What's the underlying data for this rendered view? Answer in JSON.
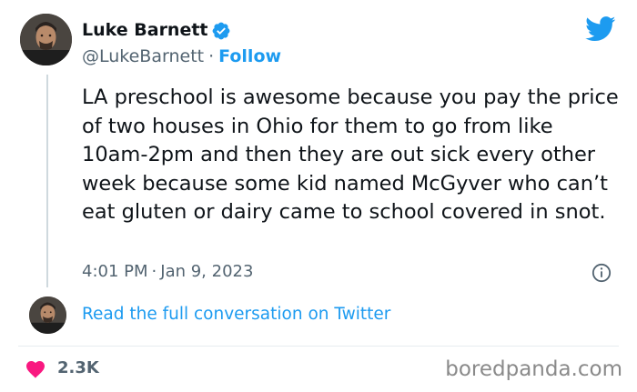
{
  "author": {
    "display_name": "Luke Barnett",
    "handle": "@LukeBarnett",
    "separator": "·",
    "follow_label": "Follow",
    "avatar_icon": "avatar-photo",
    "verified_icon": "verified-badge-icon"
  },
  "tweet": {
    "text": "LA preschool is awesome because you pay the price of two houses in Ohio for them to go from like 10am-2pm and then they are out sick every other week because some kid named McGyver who can’t eat gluten or dairy came to school covered in snot.",
    "time": "4:01 PM",
    "separator": "·",
    "date": "Jan 9, 2023"
  },
  "conversation_link": "Read the full conversation on Twitter",
  "likes": {
    "count": "2.3K",
    "icon": "heart-icon"
  },
  "watermark": "boredpanda.com",
  "colors": {
    "accent": "#1d9bf0",
    "text": "#0f1419",
    "muted": "#536471",
    "heart": "#f91880"
  }
}
